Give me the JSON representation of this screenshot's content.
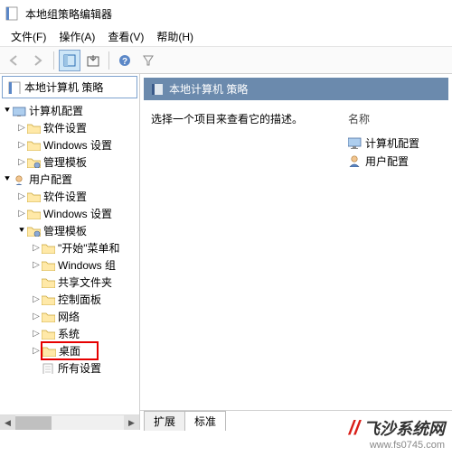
{
  "window": {
    "title": "本地组策略编辑器"
  },
  "menu": {
    "file": "文件(F)",
    "action": "操作(A)",
    "view": "查看(V)",
    "help": "帮助(H)"
  },
  "tree": {
    "root": "本地计算机 策略",
    "computer_config": "计算机配置",
    "software_settings": "软件设置",
    "windows_settings": "Windows 设置",
    "admin_templates": "管理模板",
    "user_config": "用户配置",
    "start_menu": "\"开始\"菜单和",
    "windows_components": "Windows 组",
    "shared_folders": "共享文件夹",
    "control_panel": "控制面板",
    "network": "网络",
    "system": "系统",
    "desktop": "桌面",
    "all_settings": "所有设置"
  },
  "detail": {
    "header": "本地计算机 策略",
    "prompt": "选择一个项目来查看它的描述。",
    "name_col": "名称",
    "item_computer": "计算机配置",
    "item_user": "用户配置"
  },
  "tabs": {
    "extended": "扩展",
    "standard": "标准"
  },
  "watermark": {
    "text": "飞沙系统网",
    "url": "www.fs0745.com"
  }
}
